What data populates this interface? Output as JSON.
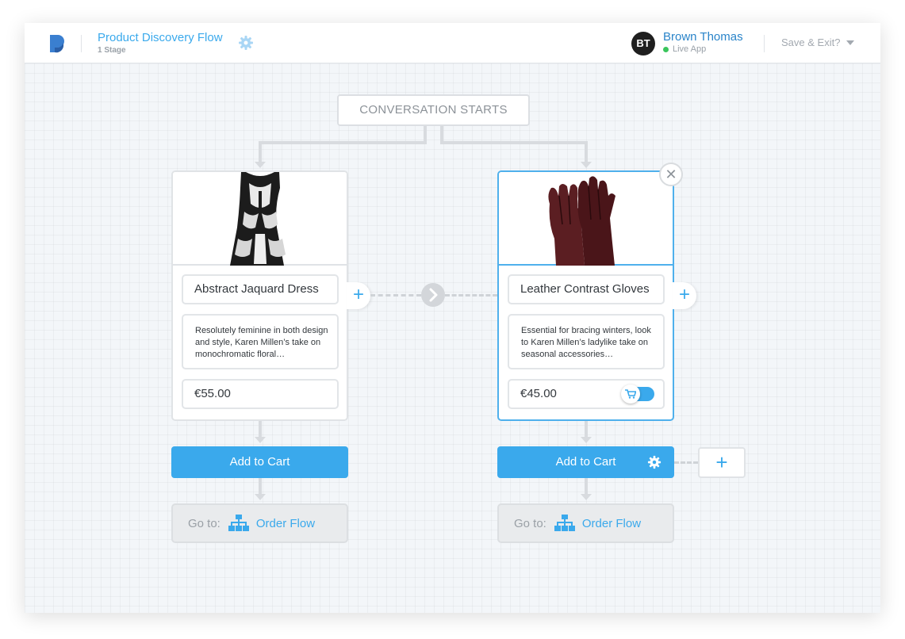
{
  "header": {
    "flow_title": "Product Discovery Flow",
    "stage_count": "1 Stage",
    "user_initials": "BT",
    "user_name": "Brown Thomas",
    "user_status": "Live App",
    "save_exit": "Save & Exit?"
  },
  "canvas": {
    "start_node": "CONVERSATION STARTS",
    "cards": [
      {
        "title": "Abstract Jaquard Dress",
        "description": "Resolutely feminine in both design and style, Karen Millen’s take on monochromatic floral…",
        "price": "€55.00",
        "button": "Add to Cart",
        "goto_label": "Go to:",
        "goto_target": "Order Flow"
      },
      {
        "title": "Leather Contrast Gloves",
        "description": "Essential for bracing winters, look to Karen Millen’s ladylike take on seasonal accessories…",
        "price": "€45.00",
        "button": "Add to Cart",
        "goto_label": "Go to:",
        "goto_target": "Order Flow"
      }
    ]
  },
  "icons": {
    "add": "+",
    "close": "✕"
  },
  "colors": {
    "accent": "#3aa9ec",
    "live_status": "#3ac55c"
  }
}
